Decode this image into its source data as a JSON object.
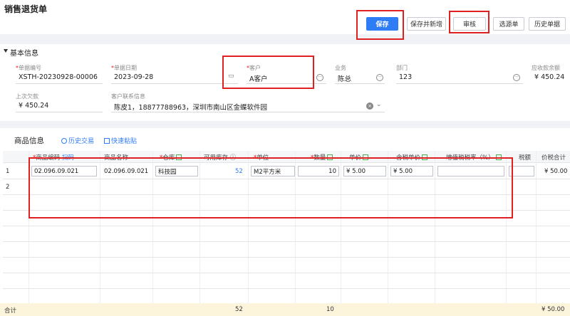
{
  "header": {
    "title": "销售退货单",
    "buttons": {
      "save": "保存",
      "save_new": "保存并新增",
      "audit": "审核",
      "select_source": "选源单",
      "history": "历史单据"
    }
  },
  "basic_info": {
    "section_title": "基本信息",
    "bill_no_label": "单据编号",
    "bill_no": "XSTH-20230928-00006",
    "date_label": "单据日期",
    "date": "2023-09-28",
    "customer_label": "客户",
    "customer": "A客户",
    "salesman_label": "业务",
    "salesman": "陈总",
    "dept_label": "部门",
    "dept": "123",
    "receivable_label": "应收款余额",
    "receivable": "¥ 450.24",
    "last_debt_label": "上次欠款",
    "last_debt": "¥ 450.24",
    "contact_label": "客户联系信息",
    "contact": "陈皮1，18877788963，深圳市南山区金蝶软件园"
  },
  "goods": {
    "title": "商品信息",
    "history_link": "历史交易",
    "paste_link": "快速粘贴",
    "columns": {
      "code": "商品编码",
      "scan": "扫码",
      "name": "商品名称",
      "warehouse": "仓库",
      "stock": "可用库存",
      "unit": "单位",
      "qty": "数量",
      "price": "单价",
      "tax_price": "含税单价",
      "vat_rate": "增值税税率（%）",
      "tax": "税额",
      "amount": "价税合计"
    },
    "rows": [
      {
        "no": "1",
        "code": "02.096.09.021",
        "name": "02.096.09.021",
        "warehouse": "科技园",
        "stock": "52",
        "unit": "M2平方米",
        "qty": "10",
        "price": "¥ 5.00",
        "tax_price": "¥ 5.00",
        "vat_rate": "",
        "tax": "",
        "amount": "¥ 50.00"
      },
      {
        "no": "2"
      }
    ],
    "footer": {
      "label": "合计",
      "stock_total": "52",
      "qty_total": "10",
      "amount_total": "¥ 50.00"
    }
  }
}
